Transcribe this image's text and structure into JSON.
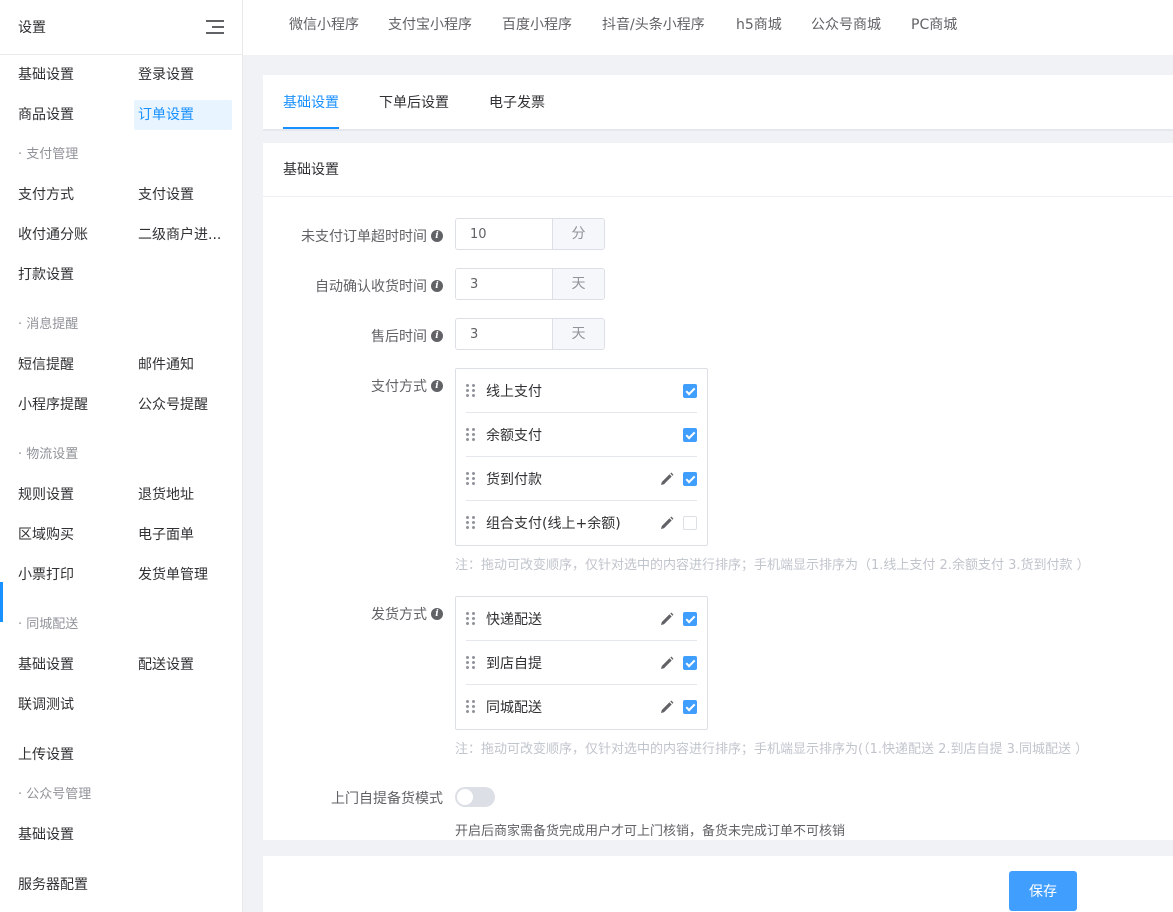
{
  "sidebar": {
    "title": "设置",
    "rows": [
      {
        "c1": "基础设置",
        "c2": "登录设置"
      },
      {
        "c1": "商品设置",
        "c2": "订单设置"
      },
      {
        "section": "· 支付管理"
      },
      {
        "c1": "支付方式",
        "c2": "支付设置"
      },
      {
        "c1": "收付通分账",
        "c2": "二级商户进..."
      },
      {
        "c1": "打款设置"
      },
      {
        "section": "· 消息提醒"
      },
      {
        "c1": "短信提醒",
        "c2": "邮件通知"
      },
      {
        "c1": "小程序提醒",
        "c2": "公众号提醒"
      },
      {
        "section": "· 物流设置"
      },
      {
        "c1": "规则设置",
        "c2": "退货地址"
      },
      {
        "c1": "区域购买",
        "c2": "电子面单"
      },
      {
        "c1": "小票打印",
        "c2": "发货单管理"
      },
      {
        "section": "· 同城配送"
      },
      {
        "c1": "基础设置",
        "c2": "配送设置"
      },
      {
        "c1": "联调测试"
      },
      {
        "c1": "上传设置"
      },
      {
        "section": "· 公众号管理"
      },
      {
        "c1": "基础设置"
      },
      {
        "c1": "服务器配置"
      }
    ]
  },
  "top_tabs": [
    "微信小程序",
    "支付宝小程序",
    "百度小程序",
    "抖音/头条小程序",
    "h5商城",
    "公众号商城",
    "PC商城"
  ],
  "sub_tabs": [
    "基础设置",
    "下单后设置",
    "电子发票"
  ],
  "card": {
    "title": "基础设置",
    "unpaid_timeout": {
      "label": "未支付订单超时时间",
      "value": "10",
      "unit": "分"
    },
    "auto_confirm": {
      "label": "自动确认收货时间",
      "value": "3",
      "unit": "天"
    },
    "after_sale": {
      "label": "售后时间",
      "value": "3",
      "unit": "天"
    },
    "payment": {
      "label": "支付方式",
      "items": [
        {
          "name": "线上支付",
          "editable": false,
          "checked": true
        },
        {
          "name": "余额支付",
          "editable": false,
          "checked": true
        },
        {
          "name": "货到付款",
          "editable": true,
          "checked": true
        },
        {
          "name": "组合支付(线上+余额)",
          "editable": true,
          "checked": false
        }
      ],
      "note": "注：拖动可改变顺序，仅针对选中的内容进行排序；手机端显示排序为（1.线上支付 2.余额支付 3.货到付款 ）"
    },
    "delivery": {
      "label": "发货方式",
      "items": [
        {
          "name": "快递配送",
          "editable": true,
          "checked": true
        },
        {
          "name": "到店自提",
          "editable": true,
          "checked": true
        },
        {
          "name": "同城配送",
          "editable": true,
          "checked": true
        }
      ],
      "note": "注：拖动可改变顺序，仅针对选中的内容进行排序；手机端显示排序为(（1.快递配送 2.到店自提 3.同城配送 ）"
    },
    "pickup_mode": {
      "label": "上门自提备货模式",
      "enabled": false,
      "desc": "开启后商家需备货完成用户才可上门核销，备货未完成订单不可核销"
    }
  },
  "save_label": "保存",
  "colors": {
    "accent": "#1890ff",
    "button": "#409eff"
  }
}
